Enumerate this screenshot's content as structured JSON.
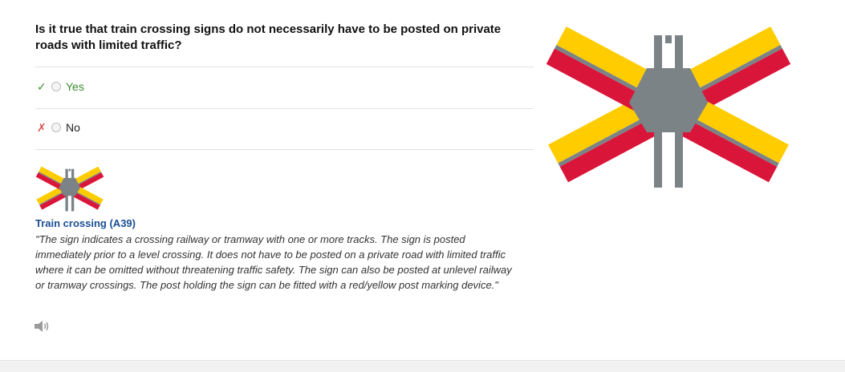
{
  "question": "Is it true that train crossing signs do not necessarily have to be posted on private roads with limited traffic?",
  "answers": [
    {
      "label": "Yes",
      "mark": "✓",
      "status": "correct"
    },
    {
      "label": "No",
      "mark": "✗",
      "status": "incorrect"
    }
  ],
  "explanation": {
    "sign_title": "Train crossing (A39)",
    "text": "\"The sign indicates a crossing railway or tramway with one or more tracks. The sign is posted immediately prior to a level crossing. It does not have to be posted on a private road with limited traffic where it can be omitted without threatening traffic safety. The sign can also be posted at unlevel railway or tramway crossings. The post holding the sign can be fitted with a red/yellow post marking device.\""
  },
  "icons": {
    "correct_mark": "check-icon",
    "wrong_mark": "x-icon",
    "audio": "speaker-icon",
    "sign": "train-crossing-sign-icon"
  },
  "colors": {
    "correct_text": "#3a8a2f",
    "wrong_mark": "#d9534f",
    "sign_title": "#1a4f94",
    "sign_yellow": "#ffcc00",
    "sign_red": "#d9163a",
    "sign_gray": "#7b8387"
  }
}
